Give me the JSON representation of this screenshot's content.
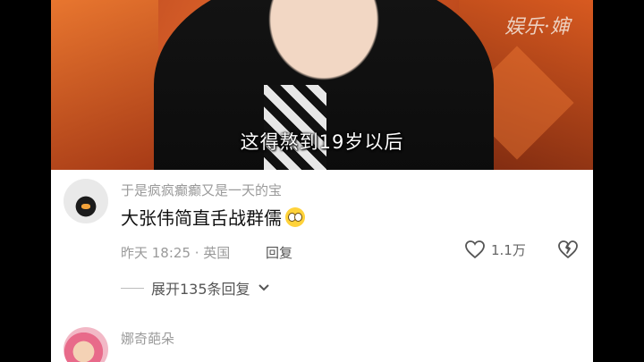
{
  "video": {
    "watermark": "娱乐·婶",
    "subtitle": "这得熬到19岁以后"
  },
  "comments": [
    {
      "username": "于是疯疯癫癫又是一天的宝",
      "text": "大张伟简直舌战群儒",
      "emoji": "flushed-face-emoji",
      "time_location": "昨天 18:25 · 英国",
      "reply_label": "回复",
      "like_count": "1.1万"
    },
    {
      "username": "娜奇葩朵"
    }
  ],
  "expand_replies": "展开135条回复"
}
